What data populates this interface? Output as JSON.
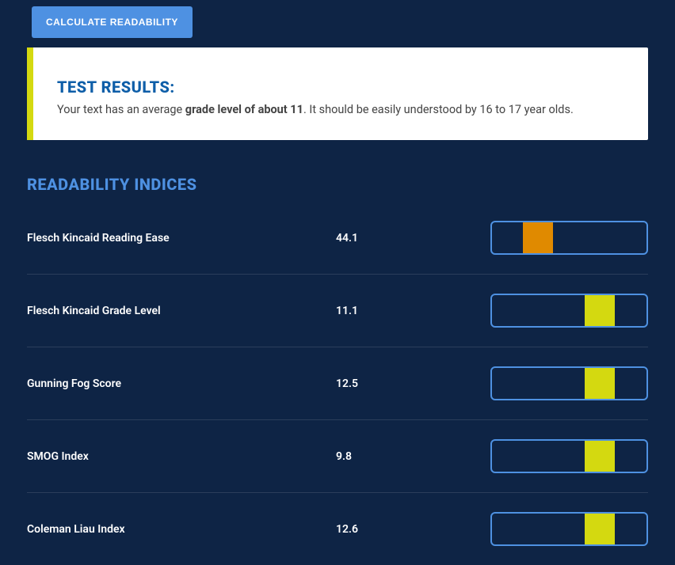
{
  "button_label": "CALCULATE READABILITY",
  "results": {
    "title": "TEST RESULTS:",
    "prefix": "Your text has an average ",
    "bold": "grade level of about 11",
    "suffix": ". It should be easily understood by 16 to 17 year olds."
  },
  "section_title": "READABILITY INDICES",
  "metrics": [
    {
      "name": "Flesch Kincaid Reading Ease",
      "value": "44.1",
      "pos_pct": 20,
      "color": "#e08a00"
    },
    {
      "name": "Flesch Kincaid Grade Level",
      "value": "11.1",
      "pos_pct": 60,
      "color": "#d4d910"
    },
    {
      "name": "Gunning Fog Score",
      "value": "12.5",
      "pos_pct": 60,
      "color": "#d4d910"
    },
    {
      "name": "SMOG Index",
      "value": "9.8",
      "pos_pct": 60,
      "color": "#d4d910"
    },
    {
      "name": "Coleman Liau Index",
      "value": "12.6",
      "pos_pct": 60,
      "color": "#d4d910"
    }
  ]
}
